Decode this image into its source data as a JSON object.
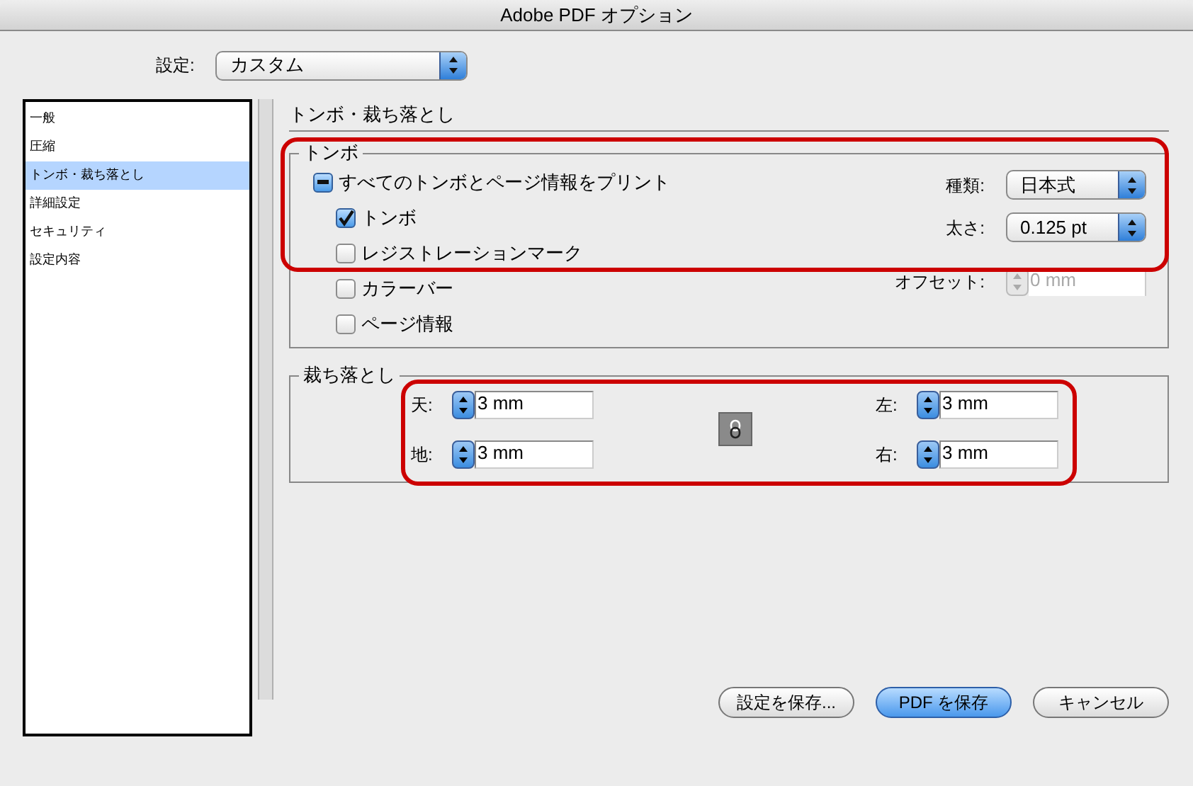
{
  "window": {
    "title": "Adobe PDF オプション"
  },
  "preset": {
    "label": "設定:",
    "value": "カスタム"
  },
  "sidebar": {
    "items": [
      {
        "label": "一般",
        "selected": false
      },
      {
        "label": "圧縮",
        "selected": false
      },
      {
        "label": "トンボ・裁ち落とし",
        "selected": true
      },
      {
        "label": "詳細設定",
        "selected": false
      },
      {
        "label": "セキュリティ",
        "selected": false
      },
      {
        "label": "設定内容",
        "selected": false
      }
    ]
  },
  "section_title": "トンボ・裁ち落とし",
  "marks": {
    "legend": "トンボ",
    "all_marks": {
      "label": "すべてのトンボとページ情報をプリント",
      "mixed": true,
      "children": [
        {
          "label": "トンボ",
          "checked": true
        },
        {
          "label": "レジストレーションマーク",
          "checked": false
        },
        {
          "label": "カラーバー",
          "checked": false
        },
        {
          "label": "ページ情報",
          "checked": false
        }
      ]
    },
    "settings": [
      {
        "kind": "select",
        "label": "種類:",
        "value": "日本式"
      },
      {
        "kind": "select",
        "label": "太さ:",
        "value": "0.125 pt"
      },
      {
        "kind": "spinner",
        "label": "オフセット:",
        "value": "0 mm",
        "disabled": true
      }
    ]
  },
  "bleed": {
    "legend": "裁ち落とし",
    "left_fields": [
      {
        "label": "天:",
        "value": "3 mm"
      },
      {
        "label": "地:",
        "value": "3 mm"
      }
    ],
    "right_fields": [
      {
        "label": "左:",
        "value": "3 mm"
      },
      {
        "label": "右:",
        "value": "3 mm"
      }
    ],
    "linked": true
  },
  "buttons": [
    {
      "label": "設定を保存...",
      "kind": "normal"
    },
    {
      "label": "PDF を保存",
      "kind": "default"
    },
    {
      "label": "キャンセル",
      "kind": "normal"
    }
  ]
}
